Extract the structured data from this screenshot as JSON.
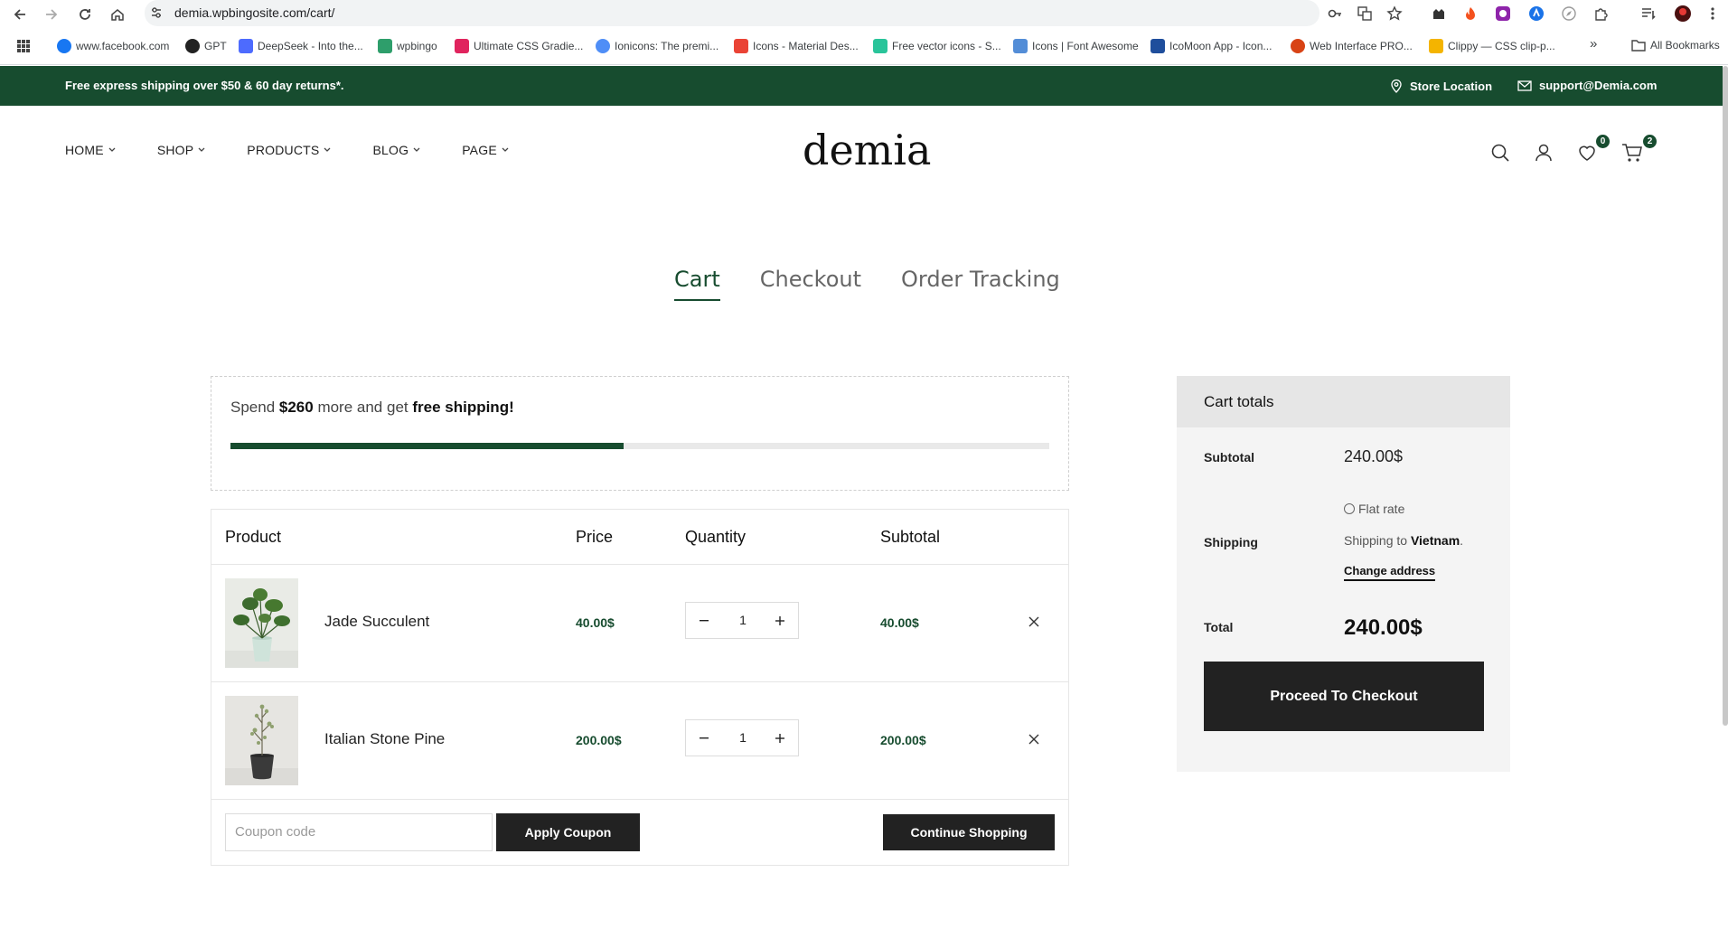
{
  "browser": {
    "url": "demia.wpbingosite.com/cart/",
    "bookmarks": [
      {
        "label": "www.facebook.com",
        "color": "#1877f2"
      },
      {
        "label": "GPT",
        "color": "#222222"
      },
      {
        "label": "DeepSeek - Into the...",
        "color": "#4d6bfe"
      },
      {
        "label": "wpbingo",
        "color": "#2e9e6b"
      },
      {
        "label": "Ultimate CSS Gradie...",
        "color": "#e0245e"
      },
      {
        "label": "Ionicons: The premi...",
        "color": "#4f8ef7"
      },
      {
        "label": "Icons - Material Des...",
        "color": "#ea4335"
      },
      {
        "label": "Free vector icons - S...",
        "color": "#29c49a"
      },
      {
        "label": "Icons | Font Awesome",
        "color": "#538dd7"
      },
      {
        "label": "IcoMoon App - Icon...",
        "color": "#1f4e9c"
      },
      {
        "label": "Web Interface PRO...",
        "color": "#d84315"
      },
      {
        "label": "Clippy — CSS clip-p...",
        "color": "#f4b400"
      }
    ],
    "all_bookmarks": "All Bookmarks",
    "more": "»"
  },
  "topbar": {
    "promo": "Free express shipping over $50 & 60 day returns*.",
    "store_location": "Store Location",
    "email": "support@Demia.com"
  },
  "nav": {
    "items": [
      "HOME",
      "SHOP",
      "PRODUCTS",
      "BLOG",
      "PAGE"
    ],
    "logo": "demia",
    "wishlist_count": "0",
    "cart_count": "2"
  },
  "tabs": [
    "Cart",
    "Checkout",
    "Order Tracking"
  ],
  "free_shipping": {
    "prefix": "Spend ",
    "amount": "$260",
    "middle": " more and get ",
    "highlight": "free shipping!",
    "progress": 0.48
  },
  "table": {
    "headers": {
      "product": "Product",
      "price": "Price",
      "quantity": "Quantity",
      "subtotal": "Subtotal"
    },
    "rows": [
      {
        "name": "Jade Succulent",
        "price": "40.00$",
        "qty": "1",
        "subtotal": "40.00$"
      },
      {
        "name": "Italian Stone Pine",
        "price": "200.00$",
        "qty": "1",
        "subtotal": "200.00$"
      }
    ],
    "coupon_placeholder": "Coupon code",
    "apply_coupon": "Apply Coupon",
    "continue_shopping": "Continue Shopping"
  },
  "totals": {
    "title": "Cart totals",
    "subtotal_label": "Subtotal",
    "subtotal_value": "240.00$",
    "shipping_label": "Shipping",
    "flat_rate": "Flat rate",
    "shipping_to": "Shipping to ",
    "country": "Vietnam",
    "period": ".",
    "change_address": "Change address",
    "total_label": "Total",
    "total_value": "240.00$",
    "proceed": "Proceed To Checkout"
  },
  "colors": {
    "brand_green": "#174c2f",
    "dark_button": "#222222"
  }
}
